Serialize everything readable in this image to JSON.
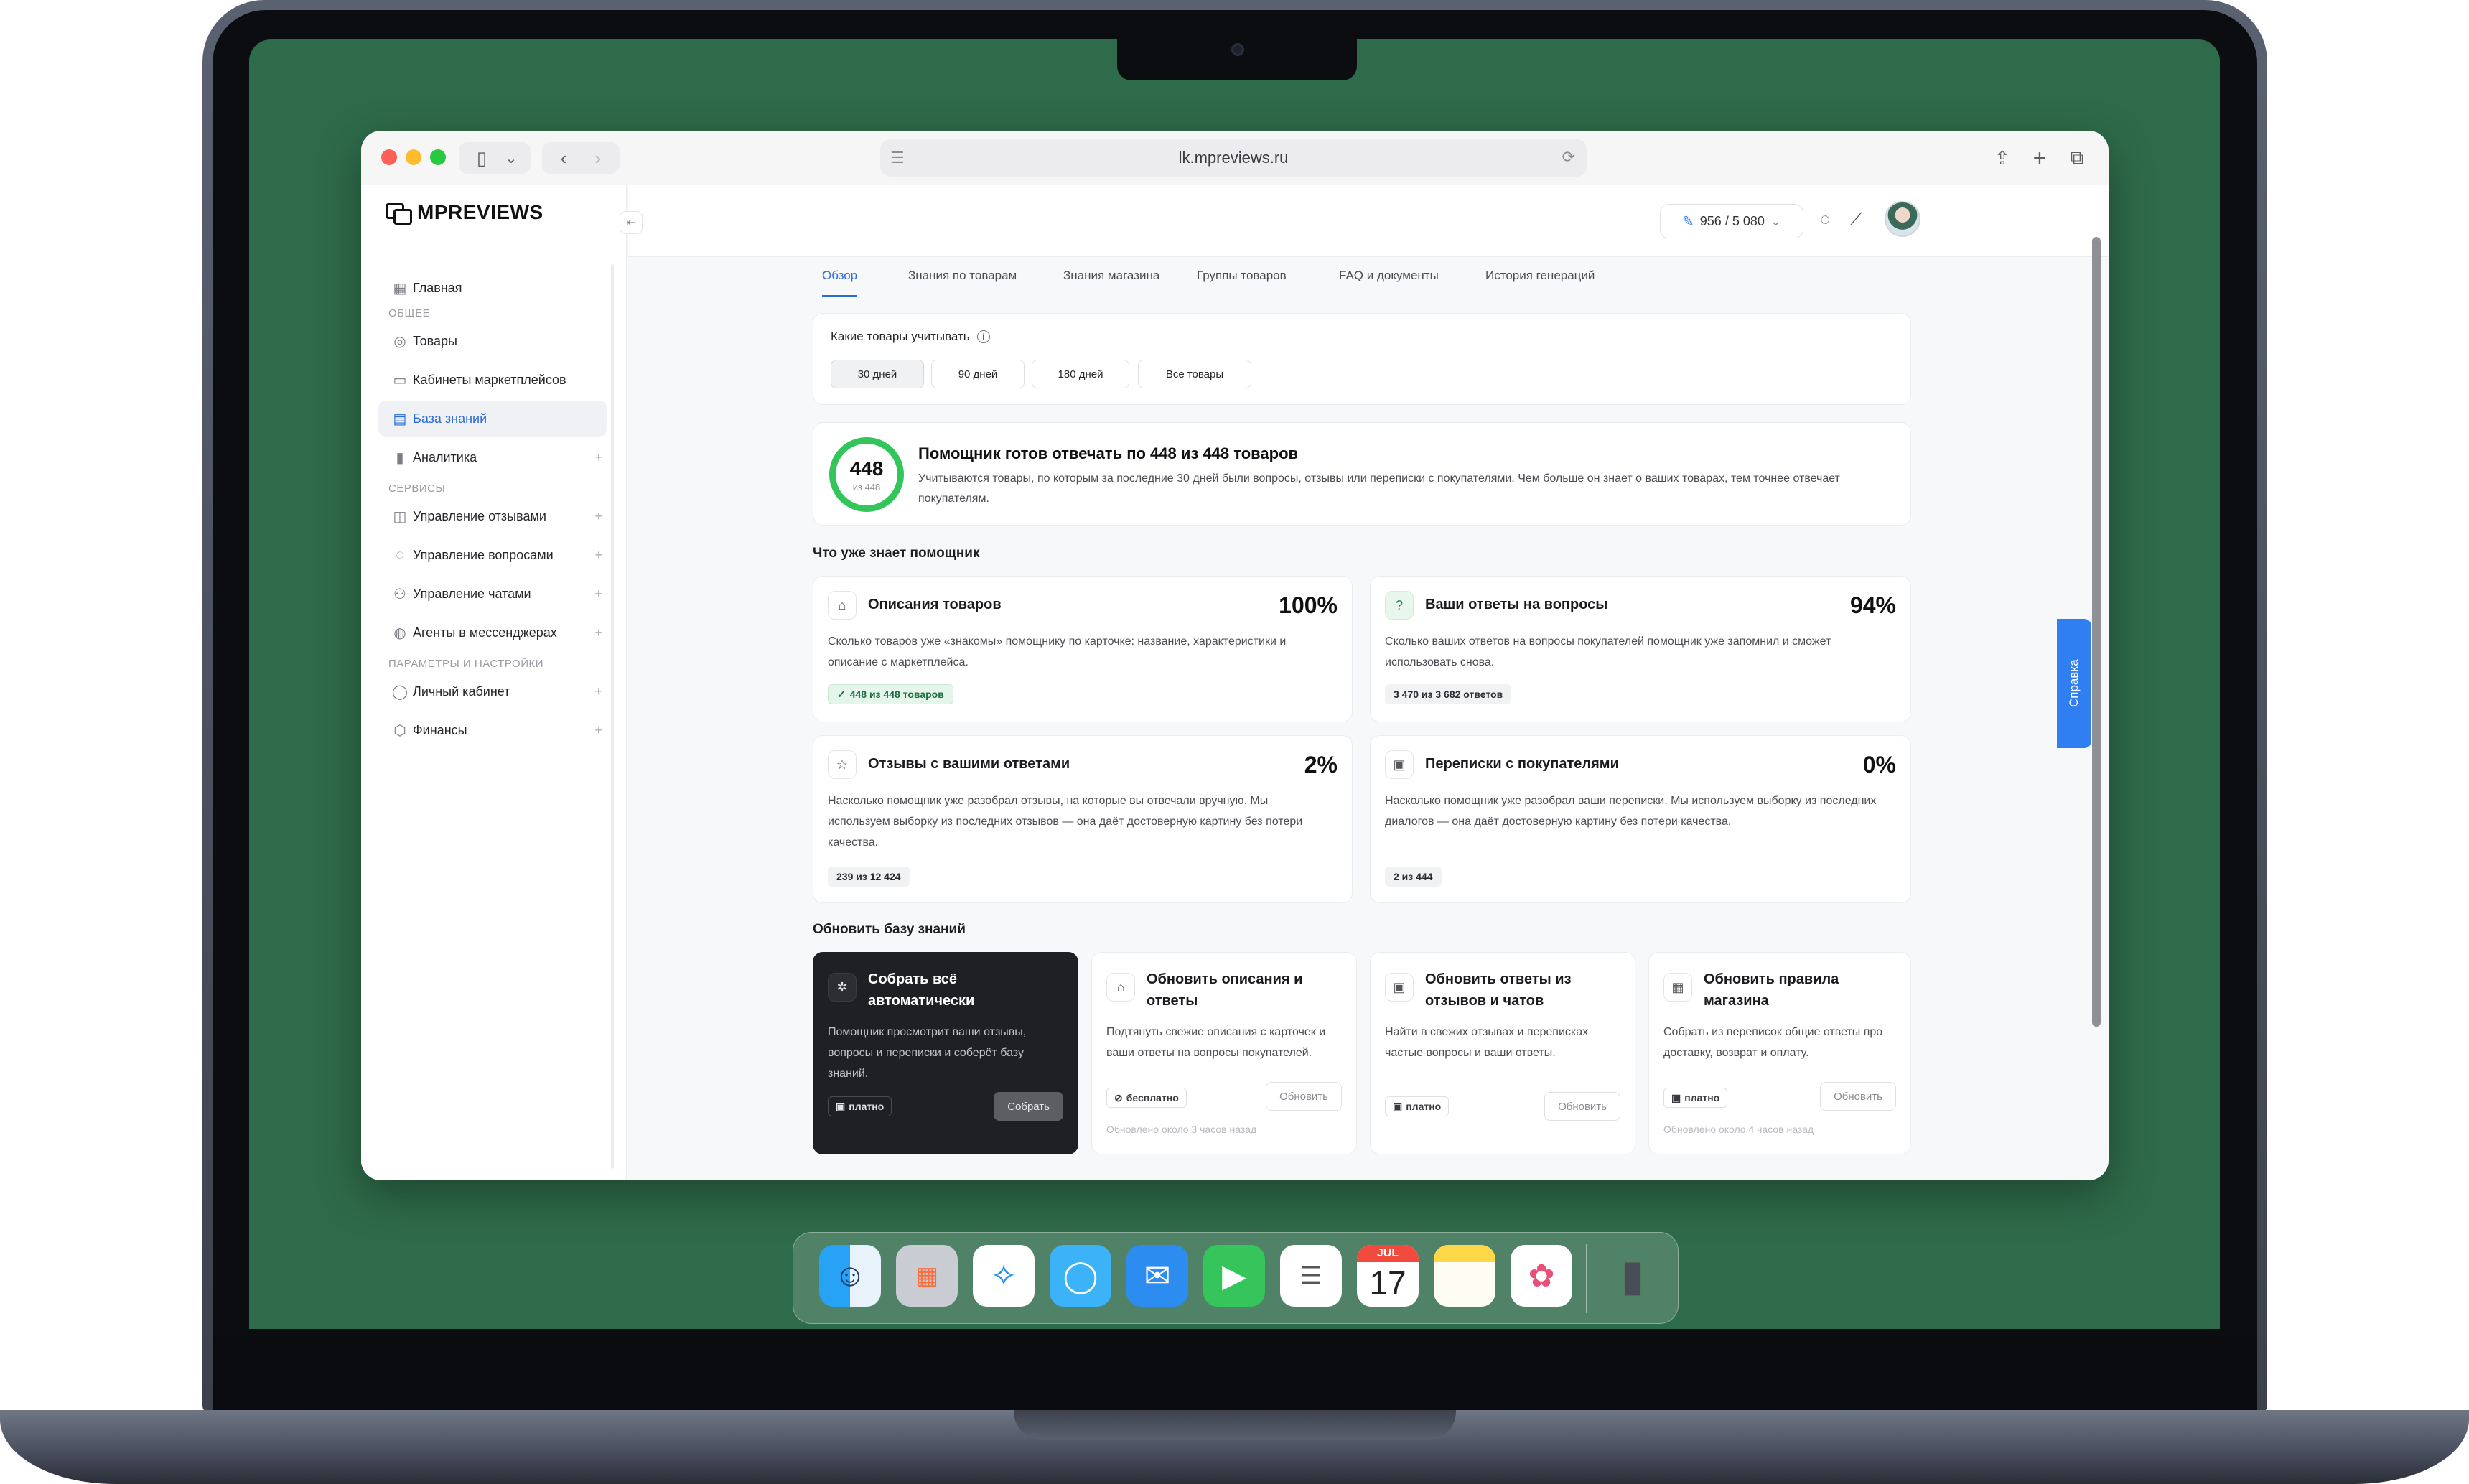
{
  "browser": {
    "url": "lk.mpreviews.ru"
  },
  "sidebar": {
    "logo": "MPREVIEWS",
    "collapse_glyph": "⇤",
    "items": [
      {
        "label": "Главная",
        "icon": "grid-icon",
        "glyph": "▦",
        "plus": ""
      },
      {
        "label": "Товары",
        "icon": "box-icon",
        "glyph": "◎",
        "plus": ""
      },
      {
        "label": "Кабинеты маркетплейсов",
        "icon": "store-icon",
        "glyph": "▭",
        "plus": ""
      },
      {
        "label": "База знаний",
        "icon": "archive-icon",
        "glyph": "▤",
        "plus": ""
      },
      {
        "label": "Аналитика",
        "icon": "chart-icon",
        "glyph": "▮",
        "plus": "+"
      },
      {
        "label": "Управление отзывами",
        "icon": "reviews-icon",
        "glyph": "◫",
        "plus": "+"
      },
      {
        "label": "Управление вопросами",
        "icon": "question-icon",
        "glyph": "◌",
        "plus": "+"
      },
      {
        "label": "Управление чатами",
        "icon": "chat-icon",
        "glyph": "⚇",
        "plus": "+"
      },
      {
        "label": "Агенты в мессенджерах",
        "icon": "agent-icon",
        "glyph": "◍",
        "plus": "+"
      },
      {
        "label": "Личный кабинет",
        "icon": "user-icon",
        "glyph": "◯",
        "plus": "+"
      },
      {
        "label": "Финансы",
        "icon": "wallet-icon",
        "glyph": "⬡",
        "plus": "+"
      }
    ],
    "sections": [
      "ОБЩЕЕ",
      "СЕРВИСЫ",
      "ПАРАМЕТРЫ И НАСТРОЙКИ"
    ]
  },
  "topbar": {
    "credits": "956 / 5 080",
    "credits_icon": "✎",
    "credits_caret": "⌄"
  },
  "tabs": [
    "Обзор",
    "Знания по товарам",
    "Знания магазина",
    "Группы товаров",
    "FAQ и документы",
    "История генераций"
  ],
  "filter": {
    "label": "Какие товары учитывать",
    "info": "i",
    "options": [
      "30 дней",
      "90 дней",
      "180 дней",
      "Все товары"
    ],
    "selected": "30 дней"
  },
  "summary": {
    "count": "448",
    "total": "из 448",
    "progress": 1.0,
    "title": "Помощник готов отвечать по 448 из 448 товаров",
    "description": "Учитываются товары, по которым за последние 30 дней были вопросы, отзывы или переписки с покупателями. Чем больше он знает о ваших товарах, тем точнее отвечает покупателям."
  },
  "knowledge": {
    "title": "Что уже знает помощник",
    "cards": [
      {
        "title": "Описания товаров",
        "percent": "100%",
        "description": "Сколько товаров уже «знакомы» помощнику по карточке: название, характеристики и описание с маркетплейса.",
        "badge": "448 из 448 товаров",
        "check": "✓",
        "glyph": "⌂"
      },
      {
        "title": "Ваши ответы на вопросы",
        "percent": "94%",
        "description": "Сколько ваших ответов на вопросы покупателей помощник уже запомнил и сможет использовать снова.",
        "badge": "3 470 из 3 682 ответов",
        "glyph": "?"
      },
      {
        "title": "Отзывы с вашими ответами",
        "percent": "2%",
        "description": "Насколько помощник уже разобрал отзывы, на которые вы отвечали вручную. Мы используем выборку из последних отзывов — она даёт достоверную картину без потери качества.",
        "badge": "239 из 12 424",
        "glyph": "☆"
      },
      {
        "title": "Переписки с покупателями",
        "percent": "0%",
        "description": "Насколько помощник уже разобрал ваши переписки. Мы используем выборку из последних диалогов — она даёт достоверную картину без потери качества.",
        "badge": "2 из 444",
        "glyph": "▣"
      }
    ]
  },
  "update": {
    "title": "Обновить базу знаний",
    "cards": [
      {
        "title": "Собрать всё автоматически",
        "description": "Помощник просмотрит ваши отзывы, вопросы и переписки и соберёт базу знаний.",
        "price": "платно",
        "price_glyph": "▣",
        "button": "Собрать",
        "updated": "",
        "glyph": "✲"
      },
      {
        "title": "Обновить описания и ответы",
        "description": "Подтянуть свежие описания с карточек и ваши ответы на вопросы покупателей.",
        "price": "бесплатно",
        "price_glyph": "⊘",
        "button": "Обновить",
        "updated": "Обновлено около 3 часов назад",
        "glyph": "⌂"
      },
      {
        "title": "Обновить ответы из отзывов и чатов",
        "description": "Найти в свежих отзывах и переписках частые вопросы и ваши ответы.",
        "price": "платно",
        "price_glyph": "▣",
        "button": "Обновить",
        "updated": "",
        "glyph": "▣"
      },
      {
        "title": "Обновить правила магазина",
        "description": "Собрать из переписок общие ответы про доставку, возврат и оплату.",
        "price": "платно",
        "price_glyph": "▣",
        "button": "Обновить",
        "updated": "Обновлено около 4 часов назад",
        "glyph": "▦"
      }
    ]
  },
  "help_tab": "Справка",
  "calendar": {
    "month": "JUL",
    "day": "17"
  },
  "colors": {
    "accent": "#2b6cdb",
    "ring": "#31c55a",
    "desktop": "#2e6b4a",
    "help": "#2f7ff3"
  }
}
